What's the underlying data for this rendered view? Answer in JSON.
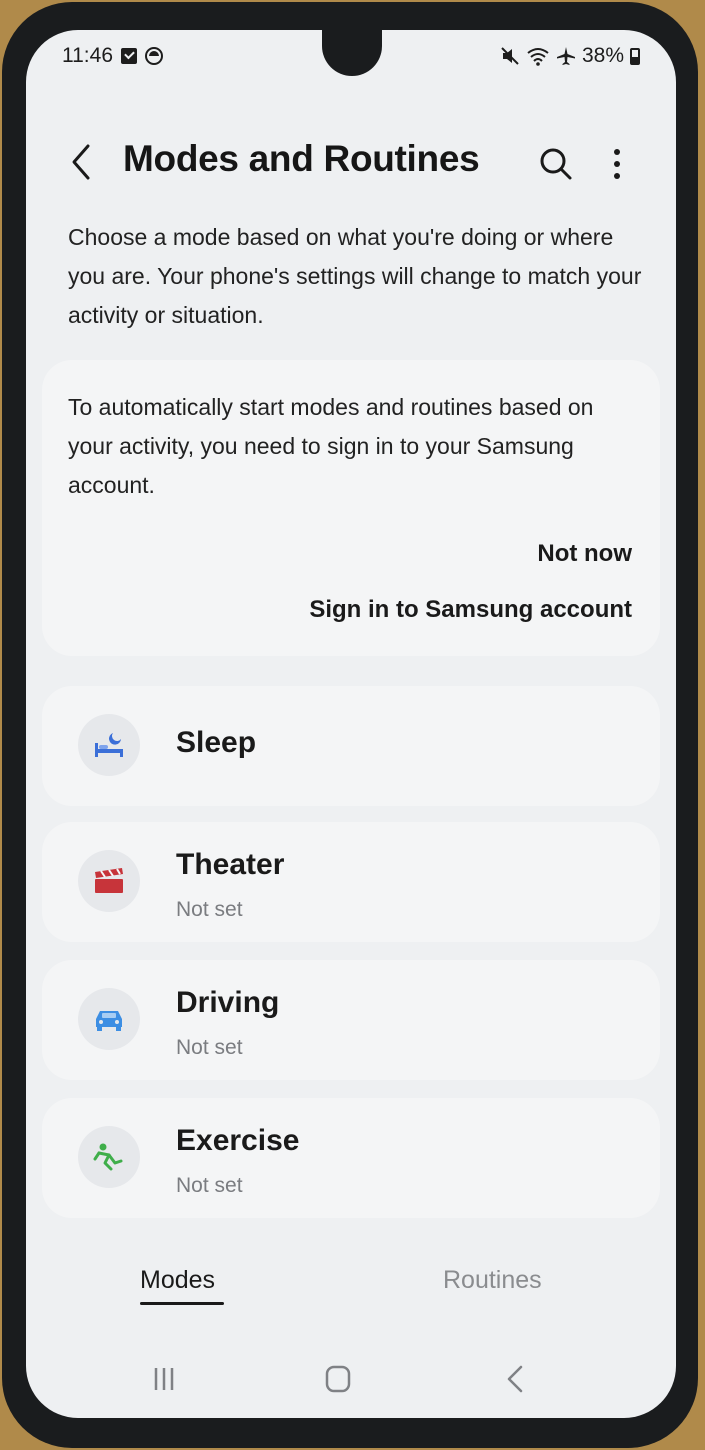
{
  "status": {
    "time": "11:46",
    "battery": "38%"
  },
  "header": {
    "title": "Modes and Routines"
  },
  "description": "Choose a mode based on what you're doing or where you are. Your phone's settings will change to match your activity or situation.",
  "signin_card": {
    "text": "To automatically start modes and routines based on your activity, you need to sign in to your Samsung account.",
    "not_now": "Not now",
    "sign_in": "Sign in to Samsung account"
  },
  "modes": [
    {
      "name": "Sleep",
      "status": "",
      "icon": "bed-icon",
      "color": "#3b6fd8"
    },
    {
      "name": "Theater",
      "status": "Not set",
      "icon": "clapperboard-icon",
      "color": "#c7343a"
    },
    {
      "name": "Driving",
      "status": "Not set",
      "icon": "car-icon",
      "color": "#3d8ee3"
    },
    {
      "name": "Exercise",
      "status": "Not set",
      "icon": "running-icon",
      "color": "#3fae4a"
    }
  ],
  "tabs": [
    {
      "label": "Modes"
    },
    {
      "label": "Routines"
    }
  ]
}
